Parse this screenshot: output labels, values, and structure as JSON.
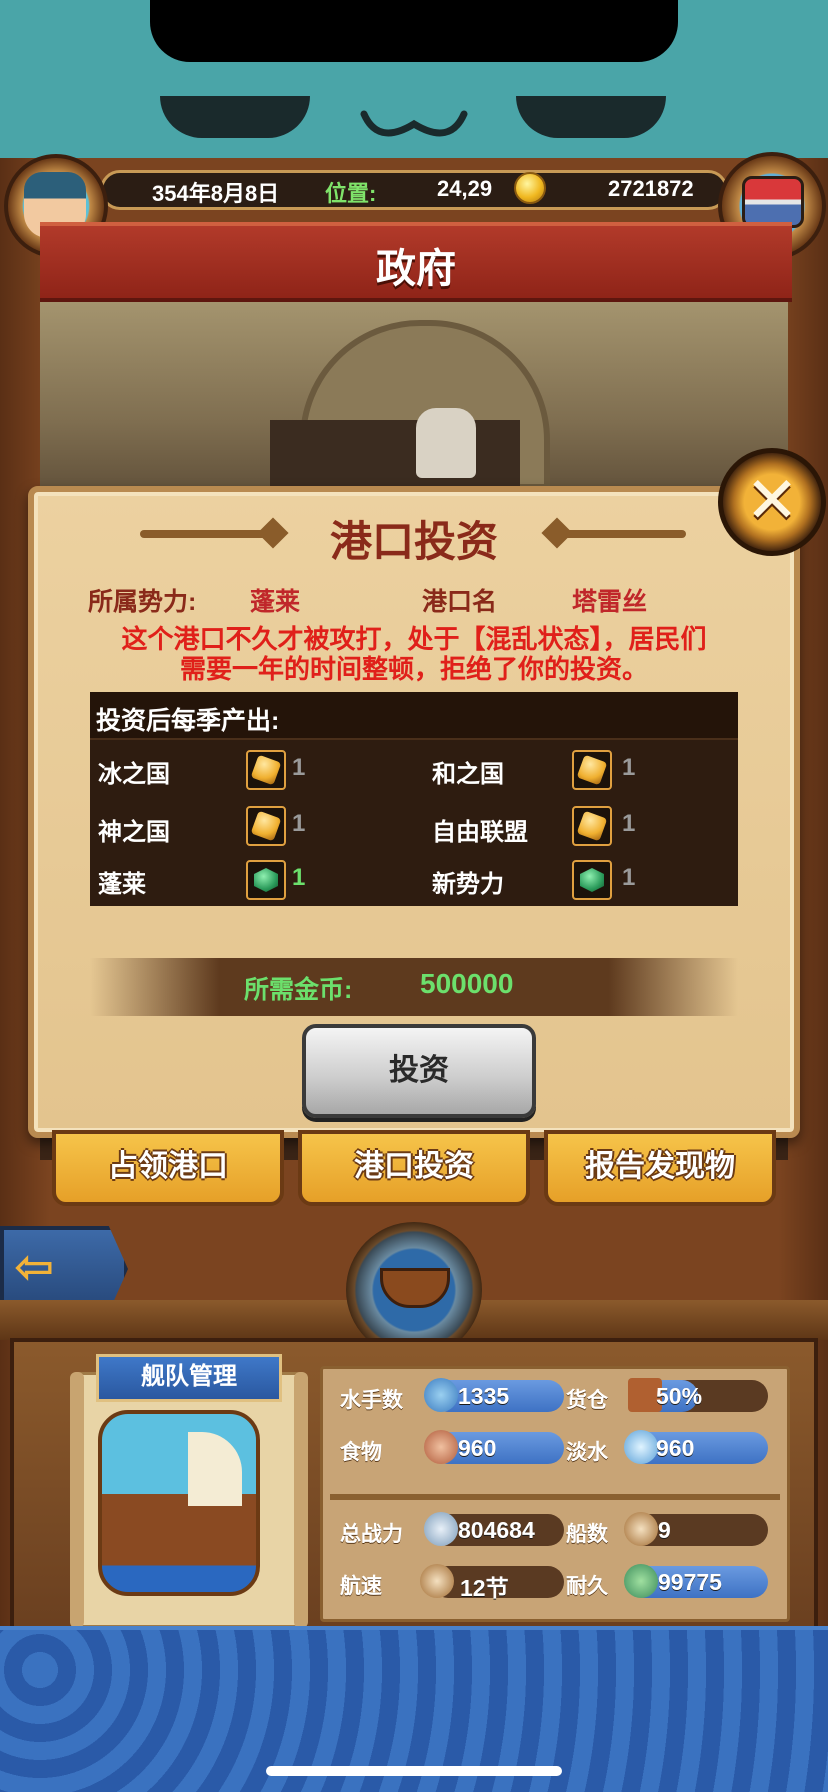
{
  "hud": {
    "date": "354年8月8日",
    "position_label": "位置:",
    "position_value": "24,29",
    "gold": "2721872"
  },
  "header": {
    "title": "政府"
  },
  "dialog": {
    "title": "港口投资",
    "faction_label": "所属势力:",
    "faction_value": "蓬莱",
    "port_label": "港口名",
    "port_value": "塔雷丝",
    "notice_line1": "这个港口不久才被攻打，处于【混乱状态】，居民们",
    "notice_line2": "需要一年的时间整顿，拒绝了你的投资。",
    "output_title": "投资后每季产出:",
    "outputs": [
      {
        "name": "冰之国",
        "icon": "gold-ore-icon",
        "count": "1",
        "highlight": false
      },
      {
        "name": "和之国",
        "icon": "gold-ore-icon",
        "count": "1",
        "highlight": false
      },
      {
        "name": "神之国",
        "icon": "gold-ore-icon",
        "count": "1",
        "highlight": false
      },
      {
        "name": "自由联盟",
        "icon": "gold-ore-icon",
        "count": "1",
        "highlight": false
      },
      {
        "name": "蓬莱",
        "icon": "green-gem-icon",
        "count": "1",
        "highlight": true
      },
      {
        "name": "新势力",
        "icon": "green-gem-icon",
        "count": "1",
        "highlight": false
      }
    ],
    "cost_label": "所需金币:",
    "cost_value": "500000",
    "invest_button": "投资"
  },
  "tabs": {
    "occupy": "占领港口",
    "invest": "港口投资",
    "report": "报告发现物"
  },
  "fleet": {
    "title": "舰队管理",
    "sailors_label": "水手数",
    "sailors_value": "1335",
    "cargo_label": "货仓",
    "cargo_value": "50%",
    "food_label": "食物",
    "food_value": "960",
    "water_label": "淡水",
    "water_value": "960",
    "power_label": "总战力",
    "power_value": "804684",
    "ships_label": "船数",
    "ships_value": "9",
    "speed_label": "航速",
    "speed_value": "12节",
    "durability_label": "耐久",
    "durability_value": "99775"
  },
  "colors": {
    "accent_green": "#6ce06c",
    "warning_red": "#e0201a",
    "banner_red": "#b23a2a"
  }
}
